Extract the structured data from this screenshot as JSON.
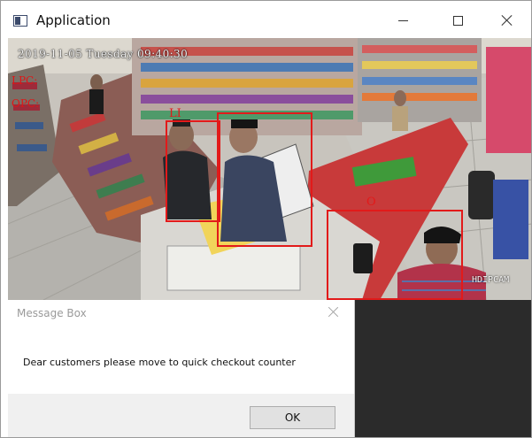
{
  "window": {
    "title": "Application",
    "icon": "app-window-icon",
    "controls": [
      "minimize-icon",
      "maximize-icon",
      "close-icon"
    ]
  },
  "video": {
    "timestamp": "2019-11-05 Tuesday 09:40:30",
    "watermark": "HDIPCAM",
    "overlays": {
      "lpc": "LPC:",
      "opc": "OPC:"
    },
    "detections": [
      {
        "label": "LI"
      },
      {
        "label": ""
      },
      {
        "label": "O"
      }
    ],
    "box_color": "#e21a1a"
  },
  "message_box": {
    "title": "Message Box",
    "message": "Dear customers please move to quick checkout counter",
    "ok_label": "OK"
  }
}
